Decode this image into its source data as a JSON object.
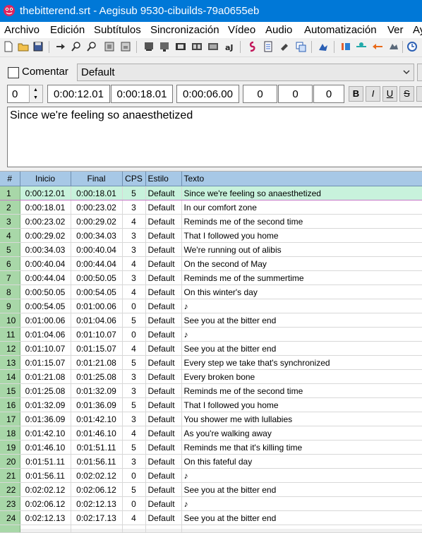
{
  "window": {
    "title": "thebitterend.srt - Aegisub 9530-cibuilds-79a0655eb"
  },
  "menu": [
    "Archivo",
    "Edición",
    "Subtítulos",
    "Sincronización",
    "Vídeo",
    "Audio",
    "Automatización",
    "Ver",
    "Ay"
  ],
  "toolbar": {
    "icons": [
      "new-file-icon",
      "open-folder-icon",
      "save-icon",
      "jump-to-icon",
      "zoom-in-icon",
      "zoom-out-icon",
      "snap-start-icon",
      "snap-end-icon",
      "video-frame-icon",
      "video-jump-icon",
      "film-strip-icon",
      "keyframe-icon",
      "video-box-icon",
      "subtitle-format-icon",
      "style-manager-icon",
      "properties-icon",
      "attachments-icon",
      "fonts-collector-icon",
      "automation-icon",
      "resample-icon",
      "translation-icon",
      "spell-check-icon",
      "timing-post-icon",
      "kanji-timer-icon",
      "options-icon"
    ]
  },
  "editor": {
    "comment_label": "Comentar",
    "style": "Default",
    "layer": "0",
    "start": "0:00:12.01",
    "end": "0:00:18.01",
    "duration": "0:00:06.00",
    "margin_l": "0",
    "margin_r": "0",
    "margin_v": "0",
    "bold": "B",
    "italic": "I",
    "underline": "U",
    "strike": "S",
    "text": "Since we're feeling so anaesthetized"
  },
  "grid": {
    "headers": {
      "num": "#",
      "start": "Inicio",
      "end": "Final",
      "cps": "CPS",
      "style": "Estilo",
      "text": "Texto"
    },
    "selected_row": 1,
    "rows": [
      {
        "num": "1",
        "start": "0:00:12.01",
        "end": "0:00:18.01",
        "cps": "5",
        "style": "Default",
        "text": "Since we're feeling so anaesthetized"
      },
      {
        "num": "2",
        "start": "0:00:18.01",
        "end": "0:00:23.02",
        "cps": "3",
        "style": "Default",
        "text": "In our comfort zone"
      },
      {
        "num": "3",
        "start": "0:00:23.02",
        "end": "0:00:29.02",
        "cps": "4",
        "style": "Default",
        "text": "Reminds me of the second time"
      },
      {
        "num": "4",
        "start": "0:00:29.02",
        "end": "0:00:34.03",
        "cps": "3",
        "style": "Default",
        "text": "That I followed you home"
      },
      {
        "num": "5",
        "start": "0:00:34.03",
        "end": "0:00:40.04",
        "cps": "3",
        "style": "Default",
        "text": "We're running out of alibis"
      },
      {
        "num": "6",
        "start": "0:00:40.04",
        "end": "0:00:44.04",
        "cps": "4",
        "style": "Default",
        "text": "On the second of May"
      },
      {
        "num": "7",
        "start": "0:00:44.04",
        "end": "0:00:50.05",
        "cps": "3",
        "style": "Default",
        "text": "Reminds me of the summertime"
      },
      {
        "num": "8",
        "start": "0:00:50.05",
        "end": "0:00:54.05",
        "cps": "4",
        "style": "Default",
        "text": "On this winter's day"
      },
      {
        "num": "9",
        "start": "0:00:54.05",
        "end": "0:01:00.06",
        "cps": "0",
        "style": "Default",
        "text": "♪"
      },
      {
        "num": "10",
        "start": "0:01:00.06",
        "end": "0:01:04.06",
        "cps": "5",
        "style": "Default",
        "text": "See you at the bitter end"
      },
      {
        "num": "11",
        "start": "0:01:04.06",
        "end": "0:01:10.07",
        "cps": "0",
        "style": "Default",
        "text": "♪"
      },
      {
        "num": "12",
        "start": "0:01:10.07",
        "end": "0:01:15.07",
        "cps": "4",
        "style": "Default",
        "text": "See you at the bitter end"
      },
      {
        "num": "13",
        "start": "0:01:15.07",
        "end": "0:01:21.08",
        "cps": "5",
        "style": "Default",
        "text": "Every step we take that's synchronized"
      },
      {
        "num": "14",
        "start": "0:01:21.08",
        "end": "0:01:25.08",
        "cps": "3",
        "style": "Default",
        "text": "Every broken bone"
      },
      {
        "num": "15",
        "start": "0:01:25.08",
        "end": "0:01:32.09",
        "cps": "3",
        "style": "Default",
        "text": "Reminds me of the second time"
      },
      {
        "num": "16",
        "start": "0:01:32.09",
        "end": "0:01:36.09",
        "cps": "5",
        "style": "Default",
        "text": "That I followed you home"
      },
      {
        "num": "17",
        "start": "0:01:36.09",
        "end": "0:01:42.10",
        "cps": "3",
        "style": "Default",
        "text": "You shower me with lullabies"
      },
      {
        "num": "18",
        "start": "0:01:42.10",
        "end": "0:01:46.10",
        "cps": "4",
        "style": "Default",
        "text": "As you're walking away"
      },
      {
        "num": "19",
        "start": "0:01:46.10",
        "end": "0:01:51.11",
        "cps": "5",
        "style": "Default",
        "text": "Reminds me that it's killing time"
      },
      {
        "num": "20",
        "start": "0:01:51.11",
        "end": "0:01:56.11",
        "cps": "3",
        "style": "Default",
        "text": "On this fateful day"
      },
      {
        "num": "21",
        "start": "0:01:56.11",
        "end": "0:02:02.12",
        "cps": "0",
        "style": "Default",
        "text": "♪"
      },
      {
        "num": "22",
        "start": "0:02:02.12",
        "end": "0:02:06.12",
        "cps": "5",
        "style": "Default",
        "text": "See you at the bitter end"
      },
      {
        "num": "23",
        "start": "0:02:06.12",
        "end": "0:02:12.13",
        "cps": "0",
        "style": "Default",
        "text": "♪"
      },
      {
        "num": "24",
        "start": "0:02:12.13",
        "end": "0:02:17.13",
        "cps": "4",
        "style": "Default",
        "text": "See you at the bitter end"
      }
    ]
  }
}
